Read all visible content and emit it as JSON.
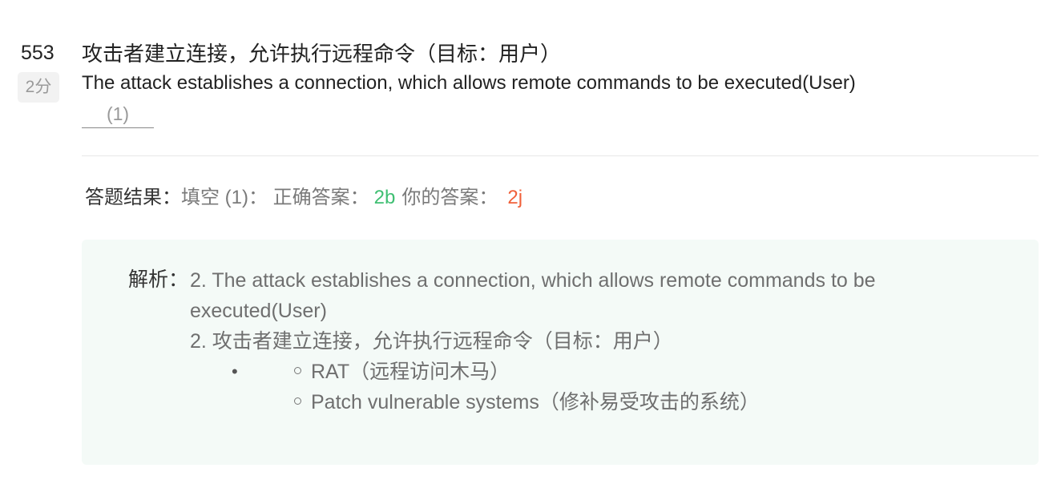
{
  "question": {
    "number": "553",
    "score": "2分",
    "title_cn": "攻击者建立连接，允许执行远程命令（目标：用户）",
    "title_en": "The attack establishes a connection, which allows remote commands to be executed(User)",
    "blank_label": "(1)"
  },
  "result": {
    "label": "答题结果：",
    "blank_desc": "填空 (1)：",
    "correct_label": "正确答案：",
    "correct_value": "2b",
    "your_label": "你的答案：",
    "your_value": "2j"
  },
  "analysis": {
    "label": "解析：",
    "line_en_1": "2. The attack establishes a connection, which allows remote commands to be",
    "line_en_2": "executed(User)",
    "line_cn": "2. 攻击者建立连接，允许执行远程命令（目标：用户）",
    "bullet": "•",
    "sub_items": [
      "RAT（远程访问木马）",
      "Patch vulnerable systems（修补易受攻击的系统）"
    ]
  },
  "colors": {
    "correct": "#3fbf72",
    "wrong": "#f0603a",
    "analysis_bg": "#f4faf7"
  }
}
